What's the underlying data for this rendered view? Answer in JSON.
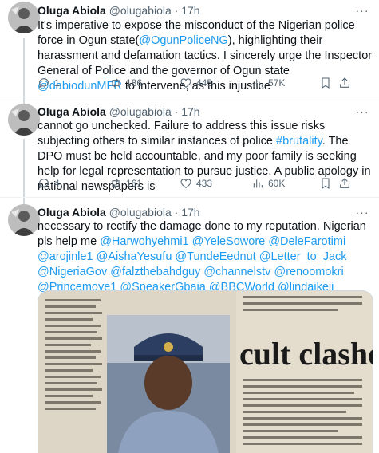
{
  "tweets": [
    {
      "name": "Oluga Abiola",
      "handle": "@olugabiola",
      "dot": "·",
      "time": "17h",
      "text": [
        {
          "t": "It's imperative to expose the misconduct of the Nigerian police force in Ogun state(",
          "link": false
        },
        {
          "t": "@OgunPoliceNG",
          "link": true
        },
        {
          "t": "), highlighting their harassment and defamation tactics. I sincerely urge the Inspector General of Police and the governor of Ogun state ",
          "link": false
        },
        {
          "t": "@dabiodunMFR",
          "link": true
        },
        {
          "t": " to intervene, as this injustice",
          "link": false
        }
      ],
      "replies": "1",
      "retweets": "186",
      "likes": "445",
      "views": "57K"
    },
    {
      "name": "Oluga Abiola",
      "handle": "@olugabiola",
      "dot": "·",
      "time": "17h",
      "text": [
        {
          "t": "cannot go unchecked. Failure to address this issue risks subjecting others to similar instances of police ",
          "link": false
        },
        {
          "t": "#brutality",
          "link": true
        },
        {
          "t": ". The DPO must be held accountable, and my poor family is seeking help for legal representation to pursue justice. A public apology in national newspapers is",
          "link": false
        }
      ],
      "replies": "4",
      "retweets": "161",
      "likes": "433",
      "views": "60K"
    },
    {
      "name": "Oluga Abiola",
      "handle": "@olugabiola",
      "dot": "·",
      "time": "17h",
      "text": [
        {
          "t": "necessary to rectify the damage done to my reputation.",
          "link": false
        },
        {
          "t": "\n",
          "link": false
        },
        {
          "t": "Nigerian pls help me ",
          "link": false
        },
        {
          "t": "@Harwohyehmi1",
          "link": true
        },
        {
          "t": " ",
          "link": false
        },
        {
          "t": "@YeleSowore",
          "link": true
        },
        {
          "t": " ",
          "link": false
        },
        {
          "t": "@DeleFarotimi",
          "link": true
        },
        {
          "t": " ",
          "link": false
        },
        {
          "t": "@arojinle1",
          "link": true
        },
        {
          "t": " ",
          "link": false
        },
        {
          "t": "@AishaYesufu",
          "link": true
        },
        {
          "t": " ",
          "link": false
        },
        {
          "t": "@TundeEednut",
          "link": true
        },
        {
          "t": " ",
          "link": false
        },
        {
          "t": "@Letter_to_Jack",
          "link": true
        },
        {
          "t": " ",
          "link": false
        },
        {
          "t": "@NigeriaGov",
          "link": true
        },
        {
          "t": " ",
          "link": false
        },
        {
          "t": "@falzthebahdguy",
          "link": true
        },
        {
          "t": " ",
          "link": false
        },
        {
          "t": "@channelstv",
          "link": true
        },
        {
          "t": " ",
          "link": false
        },
        {
          "t": "@renoomokri",
          "link": true
        },
        {
          "t": " ",
          "link": false
        },
        {
          "t": "@Princemoye1",
          "link": true
        },
        {
          "t": " ",
          "link": false
        },
        {
          "t": "@SpeakerGbaja",
          "link": true
        },
        {
          "t": " ",
          "link": false
        },
        {
          "t": "@BBCWorld",
          "link": true
        },
        {
          "t": " ",
          "link": false
        },
        {
          "t": "@lindaikeji",
          "link": true
        }
      ],
      "media": {
        "headline": "cult clashes clain"
      }
    }
  ],
  "icons": {
    "reply": "reply-icon",
    "retweet": "retweet-icon",
    "like": "heart-icon",
    "views": "views-chart-icon",
    "bookmark": "bookmark-icon",
    "share": "share-icon",
    "more": "more-dots-icon"
  },
  "colors": {
    "link": "#1d9bf0",
    "text": "#0f1419",
    "muted": "#536471",
    "divider": "#eff3f4",
    "thread_line": "#cfd9de"
  }
}
